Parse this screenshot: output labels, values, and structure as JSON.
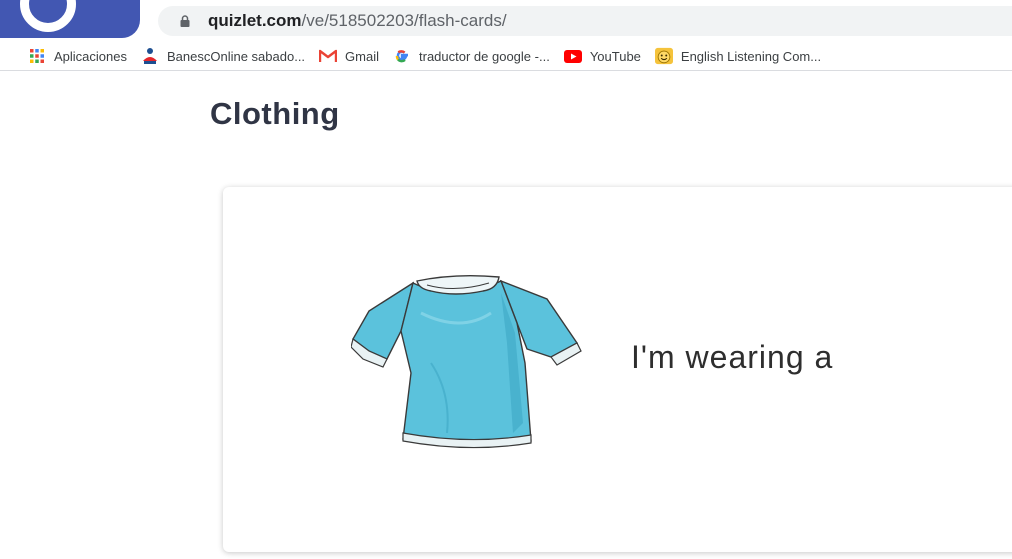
{
  "browser": {
    "url_host": "quizlet.com",
    "url_path": "/ve/518502203/flash-cards/"
  },
  "bookmarks": [
    {
      "label": "Aplicaciones",
      "icon": "apps-grid-icon"
    },
    {
      "label": "BanescOnline sabado...",
      "icon": "banesco-icon"
    },
    {
      "label": "Gmail",
      "icon": "gmail-icon"
    },
    {
      "label": "traductor de google -...",
      "icon": "google-icon"
    },
    {
      "label": "YouTube",
      "icon": "youtube-icon"
    },
    {
      "label": "English Listening Com...",
      "icon": "smiley-icon"
    }
  ],
  "page": {
    "title": "Clothing"
  },
  "flashcard": {
    "text": "I'm wearing a",
    "image": "blue-t-shirt"
  },
  "colors": {
    "brand": "#4257b2",
    "title": "#303545",
    "shirt": "#5bc2dc"
  }
}
